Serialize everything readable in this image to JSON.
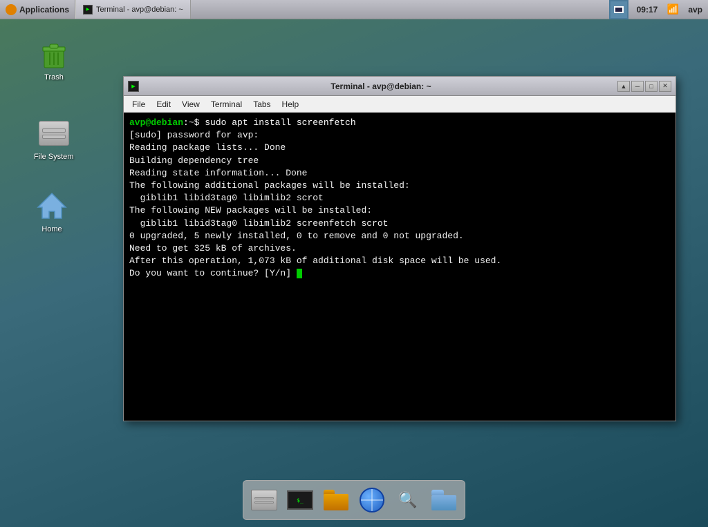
{
  "taskbar": {
    "apps_label": "Applications",
    "terminal_tab_label": "Terminal - avp@debian: ~",
    "clock": "09:17",
    "user": "avp",
    "display_icon_title": "display"
  },
  "desktop": {
    "icons": [
      {
        "id": "trash",
        "label": "Trash"
      },
      {
        "id": "filesystem",
        "label": "File System"
      },
      {
        "id": "home",
        "label": "Home"
      }
    ]
  },
  "terminal": {
    "title": "Terminal - avp@debian: ~",
    "menu_items": [
      "File",
      "Edit",
      "View",
      "Terminal",
      "Tabs",
      "Help"
    ],
    "content_lines": [
      {
        "type": "prompt_cmd",
        "prompt": "avp@debian",
        "rest": ":~$ sudo apt install screenfetch"
      },
      {
        "type": "normal",
        "text": "[sudo] password for avp:"
      },
      {
        "type": "normal",
        "text": "Reading package lists... Done"
      },
      {
        "type": "normal",
        "text": "Building dependency tree"
      },
      {
        "type": "normal",
        "text": "Reading state information... Done"
      },
      {
        "type": "normal",
        "text": "The following additional packages will be installed:"
      },
      {
        "type": "normal",
        "text": "  giblib1 libid3tag0 libimlib2 scrot"
      },
      {
        "type": "normal",
        "text": "The following NEW packages will be installed:"
      },
      {
        "type": "normal",
        "text": "  giblib1 libid3tag0 libimlib2 screenfetch scrot"
      },
      {
        "type": "normal",
        "text": "0 upgraded, 5 newly installed, 0 to remove and 0 not upgraded."
      },
      {
        "type": "normal",
        "text": "Need to get 325 kB of archives."
      },
      {
        "type": "normal",
        "text": "After this operation, 1,073 kB of additional disk space will be used."
      },
      {
        "type": "cursor",
        "text": "Do you want to continue? [Y/n] "
      }
    ],
    "controls": [
      "▲",
      "─",
      "□",
      "✕"
    ]
  },
  "dock": {
    "items": [
      {
        "id": "hdd",
        "label": "Hard Drive"
      },
      {
        "id": "terminal",
        "label": "Terminal"
      },
      {
        "id": "files",
        "label": "File Manager"
      },
      {
        "id": "globe",
        "label": "Browser"
      },
      {
        "id": "search",
        "label": "Search"
      },
      {
        "id": "folder",
        "label": "Folder"
      }
    ]
  }
}
